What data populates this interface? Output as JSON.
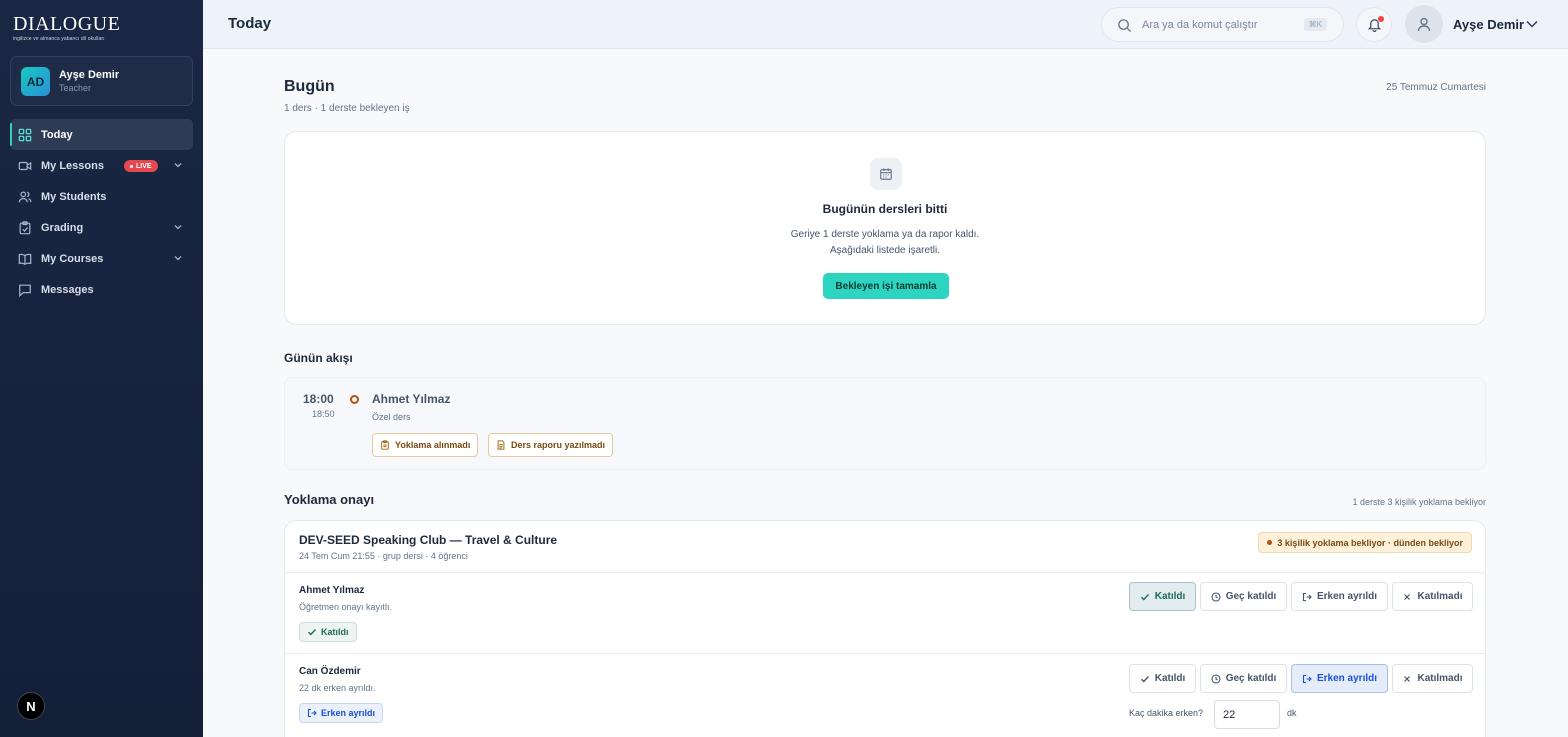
{
  "brand": {
    "name": "DIALOGUE",
    "tagline": "ingilizce ve almanca yabancı dil okulları"
  },
  "user": {
    "initials": "AD",
    "name": "Ayşe Demir",
    "role": "Teacher"
  },
  "sidebar": {
    "items": [
      {
        "label": "Today",
        "icon": "grid-icon",
        "active": true
      },
      {
        "label": "My Lessons",
        "icon": "video-icon",
        "badge": "LIVE",
        "expandable": true
      },
      {
        "label": "My Students",
        "icon": "users-icon"
      },
      {
        "label": "Grading",
        "icon": "clipboard-icon",
        "expandable": true
      },
      {
        "label": "My Courses",
        "icon": "book-icon",
        "expandable": true
      },
      {
        "label": "Messages",
        "icon": "message-icon"
      }
    ],
    "footer_badge": "N"
  },
  "topbar": {
    "title": "Today",
    "search_placeholder": "Ara ya da komut çalıştır",
    "search_shortcut": "⌘K",
    "user_name": "Ayşe Demir"
  },
  "today": {
    "heading": "Bugün",
    "summary": "1 ders · 1 derste bekleyen iş",
    "date": "25 Temmuz Cumartesi",
    "done_card": {
      "title": "Bugünün dersleri bitti",
      "line1": "Geriye 1 derste yoklama ya da rapor kaldı.",
      "line2": "Aşağıdaki listede işaretli.",
      "button": "Bekleyen işi tamamla"
    }
  },
  "flow": {
    "heading": "Günün akışı",
    "lesson": {
      "start": "18:00",
      "end": "18:50",
      "student": "Ahmet Yılmaz",
      "type": "Özel ders",
      "chips": [
        "Yoklama alınmadı",
        "Ders raporu yazılmadı"
      ]
    }
  },
  "attendance": {
    "heading": "Yoklama onayı",
    "meta": "1 derste 3 kişilik yoklama bekliyor",
    "class": {
      "title": "DEV-SEED Speaking Club — Travel & Culture",
      "meta": "24 Tem Cum 21:55 · grup dersi · 4 öğrenci",
      "pending": "3 kişilik yoklama bekliyor · dünden bekliyor"
    },
    "options": [
      "Katıldı",
      "Geç katıldı",
      "Erken ayrıldı",
      "Katılmadı"
    ],
    "students": [
      {
        "name": "Ahmet Yılmaz",
        "note": "Öğretmen onayı kayıtlı.",
        "status": "Katıldı",
        "selected": "Katıldı"
      },
      {
        "name": "Can Özdemir",
        "note": "22 dk erken ayrıldı.",
        "status": "Erken ayrıldı",
        "selected": "Erken ayrıldı",
        "early_label": "Kaç dakika erken?",
        "early_value": "22",
        "early_unit": "dk"
      }
    ]
  },
  "colors": {
    "accent": "#2dd4bf",
    "sidebar": "#1a2744",
    "live": "#e5484d",
    "warning": "#b45309"
  }
}
